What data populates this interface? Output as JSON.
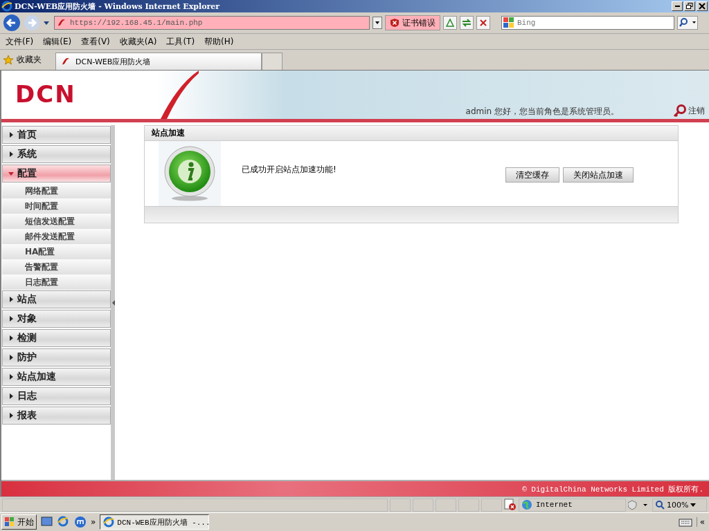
{
  "window": {
    "title": "DCN-WEB应用防火墙 - Windows Internet Explorer"
  },
  "toolbar": {
    "address": "https://192.168.45.1/main.php",
    "cert_error": "证书错误",
    "search_placeholder": "Bing"
  },
  "menu": [
    "文件(F)",
    "编辑(E)",
    "查看(V)",
    "收藏夹(A)",
    "工具(T)",
    "帮助(H)"
  ],
  "favorites": {
    "label": "收藏夹",
    "tab": "DCN-WEB应用防火墙"
  },
  "header": {
    "logo": "DCN",
    "greeting": "admin 您好，您当前角色是系统管理员。",
    "logout": "注销"
  },
  "sidebar": {
    "items": [
      {
        "label": "首页",
        "expanded": false
      },
      {
        "label": "系统",
        "expanded": false
      },
      {
        "label": "配置",
        "expanded": true,
        "children": [
          "网络配置",
          "时间配置",
          "短信发送配置",
          "邮件发送配置",
          "HA配置",
          "告警配置",
          "日志配置"
        ]
      },
      {
        "label": "站点",
        "expanded": false
      },
      {
        "label": "对象",
        "expanded": false
      },
      {
        "label": "检测",
        "expanded": false
      },
      {
        "label": "防护",
        "expanded": false
      },
      {
        "label": "站点加速",
        "expanded": false
      },
      {
        "label": "日志",
        "expanded": false
      },
      {
        "label": "报表",
        "expanded": false
      }
    ]
  },
  "panel": {
    "title": "站点加速",
    "message": "已成功开启站点加速功能!",
    "buttons": [
      "清空缓存",
      "关闭站点加速"
    ]
  },
  "footer": "© DigitalChina Networks Limited 版权所有.",
  "status_bar": {
    "zone": "Internet",
    "zoom": "100%"
  },
  "taskbar": {
    "start": "开始",
    "more": "»",
    "task": "DCN-WEB应用防火墙 -...",
    "collapse": "«"
  }
}
